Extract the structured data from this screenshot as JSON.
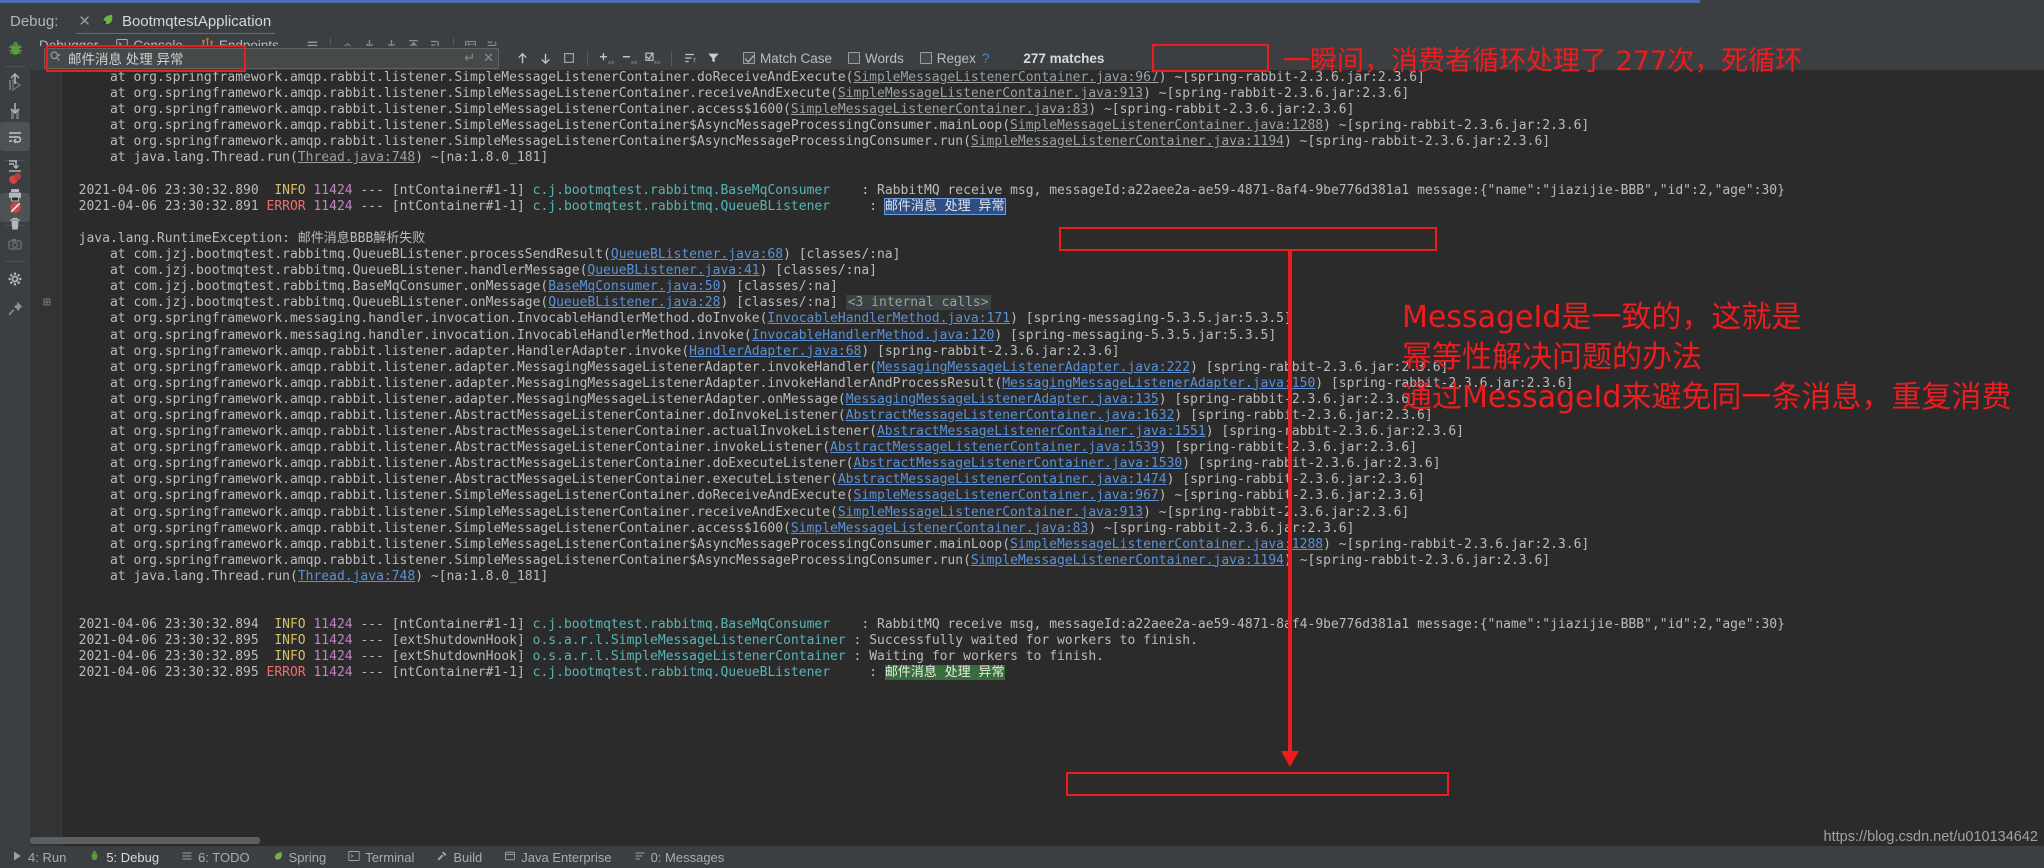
{
  "window": {
    "debug_label": "Debug:",
    "run_config_name": "BootmqtestApplication",
    "close_icon": "close-icon",
    "run_icon": "spring-boot-run-icon"
  },
  "tabs": [
    {
      "label": "Debugger",
      "icon": "",
      "active": false
    },
    {
      "label": "Console",
      "icon": "console-icon",
      "active": true
    },
    {
      "label": "Endpoints",
      "icon": "endpoints-icon",
      "active": false
    }
  ],
  "toolbar_icons": [
    "hamburger-menu-icon",
    "soft-wrap-icon",
    "scroll-to-end-icon",
    "scroll-down-icon",
    "scroll-up-icon",
    "jump-to-end-icon",
    "table-icon",
    "align-icon"
  ],
  "left_rail_icons": [
    "debug-bug-icon",
    "resume-program-icon",
    "pause-program-icon",
    "stop-icon",
    "view-breakpoints-icon",
    "mute-breakpoints-icon",
    "camera-settings-icon",
    "settings-gear-icon",
    "pin-tab-icon"
  ],
  "console_rail_icons": [
    "scroll-up-icon",
    "scroll-down-icon",
    "soft-wrap-icon",
    "scroll-to-end-icon",
    "print-icon",
    "trash-icon"
  ],
  "search": {
    "placeholder": "",
    "value": "邮件消息 处理 异常",
    "search_icon": "search-dropdown-icon",
    "newline_icon": "new-line-icon",
    "clear_icon": "clear-icon",
    "prev_icon": "find-previous-icon",
    "next_icon": "find-next-icon",
    "select_all_icon": "select-all-occurrences-icon",
    "add_icon": "add-occurrence-icon",
    "remove_icon": "remove-occurrence-icon",
    "toggle_icon": "toggle-occurrence-icon",
    "sort_icon": "sort-icon",
    "filter_icon": "filter-icon",
    "match_case": {
      "label": "Match Case",
      "checked": true
    },
    "words": {
      "label": "Words",
      "checked": false
    },
    "regex": {
      "label": "Regex",
      "checked": false
    },
    "help": "?",
    "matches": "277 matches"
  },
  "annotations": {
    "top_note": "一瞬间，消费者循环处理了 277次，死循环",
    "right_note_line1": "MessageId是一致的，这就是",
    "right_note_line2": "幂等性解决问题的办法",
    "right_note_line3": "通过MessageId来避免同一条消息，重复消费"
  },
  "statusbar": {
    "items": [
      {
        "label": "4: Run",
        "icon": "run-icon",
        "active": false
      },
      {
        "label": "5: Debug",
        "icon": "debug-bug-icon",
        "active": true
      },
      {
        "label": "6: TODO",
        "icon": "todo-icon",
        "active": false
      },
      {
        "label": "Spring",
        "icon": "spring-leaf-icon",
        "active": false
      },
      {
        "label": "Terminal",
        "icon": "terminal-icon",
        "active": false
      },
      {
        "label": "Build",
        "icon": "build-hammer-icon",
        "active": false
      },
      {
        "label": "Java Enterprise",
        "icon": "java-enterprise-icon",
        "active": false
      },
      {
        "label": "0: Messages",
        "icon": "messages-icon",
        "active": false
      }
    ],
    "watermark": "https://blog.csdn.net/u010134642"
  },
  "console_log": {
    "lines": [
      {
        "type": "trace",
        "indent": 4,
        "text": "at org.springframework.amqp.rabbit.listener.SimpleMessageListenerContainer.doReceiveAndExecute(",
        "link": "SimpleMessageListenerContainer.java:967",
        "tail": ") ~[spring-rabbit-2.3.6.jar:2.3.6]",
        "clipped_top": true
      },
      {
        "type": "trace",
        "indent": 4,
        "text": "at org.springframework.amqp.rabbit.listener.SimpleMessageListenerContainer.receiveAndExecute(",
        "link": "SimpleMessageListenerContainer.java:913",
        "tail": ") ~[spring-rabbit-2.3.6.jar:2.3.6]"
      },
      {
        "type": "trace",
        "indent": 4,
        "text": "at org.springframework.amqp.rabbit.listener.SimpleMessageListenerContainer.access$1600(",
        "link": "SimpleMessageListenerContainer.java:83",
        "tail": ") ~[spring-rabbit-2.3.6.jar:2.3.6]"
      },
      {
        "type": "trace",
        "indent": 4,
        "text": "at org.springframework.amqp.rabbit.listener.SimpleMessageListenerContainer$AsyncMessageProcessingConsumer.mainLoop(",
        "link": "SimpleMessageListenerContainer.java:1288",
        "tail": ") ~[spring-rabbit-2.3.6.jar:2.3.6]"
      },
      {
        "type": "trace",
        "indent": 4,
        "text": "at org.springframework.amqp.rabbit.listener.SimpleMessageListenerContainer$AsyncMessageProcessingConsumer.run(",
        "link": "SimpleMessageListenerContainer.java:1194",
        "tail": ") ~[spring-rabbit-2.3.6.jar:2.3.6]"
      },
      {
        "type": "trace",
        "indent": 4,
        "text": "at java.lang.Thread.run(",
        "link": "Thread.java:748",
        "tail": ") ~[na:1.8.0_181]"
      },
      {
        "type": "blank"
      },
      {
        "type": "log",
        "date": "2021-04-06 23:30:32.890",
        "level": "INFO",
        "pid": "11424",
        "thread": "[ntContainer#1-1]",
        "logger": "c.j.bootmqtest.rabbitmq.BaseMqConsumer",
        "loggerpad": "   ",
        "message": ": RabbitMQ receive msg, ",
        "boxed": "messageId:a22aee2a-ae59-4871-8af4-9be776d381a1",
        "after": " message:{\"name\":\"jiazijie-BBB\",\"id\":2,\"age\":30}"
      },
      {
        "type": "log",
        "date": "2021-04-06 23:30:32.891",
        "level": "ERROR",
        "pid": "11424",
        "thread": "[ntContainer#1-1]",
        "logger": "c.j.bootmqtest.rabbitmq.QueueBListener",
        "loggerpad": "    ",
        "message": ": ",
        "highlight_blue": "邮件消息 处理 异常"
      },
      {
        "type": "blank"
      },
      {
        "type": "exception",
        "text": "java.lang.RuntimeException: 邮件消息BBB解析失败"
      },
      {
        "type": "trace",
        "indent": 4,
        "text": "at com.jzj.bootmqtest.rabbitmq.QueueBListener.processSendResult(",
        "link": "QueueBListener.java:68",
        "tail": ") [classes/:na]"
      },
      {
        "type": "trace",
        "indent": 4,
        "text": "at com.jzj.bootmqtest.rabbitmq.QueueBListener.handlerMessage(",
        "link": "QueueBListener.java:41",
        "tail": ") [classes/:na]"
      },
      {
        "type": "trace",
        "indent": 4,
        "text": "at com.jzj.bootmqtest.rabbitmq.BaseMqConsumer.onMessage(",
        "link": "BaseMqConsumer.java:50",
        "tail": ") [classes/:na]"
      },
      {
        "type": "trace",
        "indent": 4,
        "fold": true,
        "text": "at com.jzj.bootmqtest.rabbitmq.QueueBListener.onMessage(",
        "link": "QueueBListener.java:28",
        "tail": ") [classes/:na] ",
        "folded": "<3 internal calls>"
      },
      {
        "type": "trace",
        "indent": 4,
        "text": "at org.springframework.messaging.handler.invocation.InvocableHandlerMethod.doInvoke(",
        "link": "InvocableHandlerMethod.java:171",
        "tail": ") [spring-messaging-5.3.5.jar:5.3.5]"
      },
      {
        "type": "trace",
        "indent": 4,
        "text": "at org.springframework.messaging.handler.invocation.InvocableHandlerMethod.invoke(",
        "link": "InvocableHandlerMethod.java:120",
        "tail": ") [spring-messaging-5.3.5.jar:5.3.5]"
      },
      {
        "type": "trace",
        "indent": 4,
        "text": "at org.springframework.amqp.rabbit.listener.adapter.HandlerAdapter.invoke(",
        "link": "HandlerAdapter.java:68",
        "tail": ") [spring-rabbit-2.3.6.jar:2.3.6]"
      },
      {
        "type": "trace",
        "indent": 4,
        "text": "at org.springframework.amqp.rabbit.listener.adapter.MessagingMessageListenerAdapter.invokeHandler(",
        "link": "MessagingMessageListenerAdapter.java:222",
        "tail": ") [spring-rabbit-2.3.6.jar:2.3.6]"
      },
      {
        "type": "trace",
        "indent": 4,
        "text": "at org.springframework.amqp.rabbit.listener.adapter.MessagingMessageListenerAdapter.invokeHandlerAndProcessResult(",
        "link": "MessagingMessageListenerAdapter.java:150",
        "tail": ") [spring-rabbit-2.3.6.jar:2.3.6]"
      },
      {
        "type": "trace",
        "indent": 4,
        "text": "at org.springframework.amqp.rabbit.listener.adapter.MessagingMessageListenerAdapter.onMessage(",
        "link": "MessagingMessageListenerAdapter.java:135",
        "tail": ") [spring-rabbit-2.3.6.jar:2.3.6]"
      },
      {
        "type": "trace",
        "indent": 4,
        "text": "at org.springframework.amqp.rabbit.listener.AbstractMessageListenerContainer.doInvokeListener(",
        "link": "AbstractMessageListenerContainer.java:1632",
        "tail": ") [spring-rabbit-2.3.6.jar:2.3.6]"
      },
      {
        "type": "trace",
        "indent": 4,
        "text": "at org.springframework.amqp.rabbit.listener.AbstractMessageListenerContainer.actualInvokeListener(",
        "link": "AbstractMessageListenerContainer.java:1551",
        "tail": ") [spring-rabbit-2.3.6.jar:2.3.6]"
      },
      {
        "type": "trace",
        "indent": 4,
        "text": "at org.springframework.amqp.rabbit.listener.AbstractMessageListenerContainer.invokeListener(",
        "link": "AbstractMessageListenerContainer.java:1539",
        "tail": ") [spring-rabbit-2.3.6.jar:2.3.6]"
      },
      {
        "type": "trace",
        "indent": 4,
        "text": "at org.springframework.amqp.rabbit.listener.AbstractMessageListenerContainer.doExecuteListener(",
        "link": "AbstractMessageListenerContainer.java:1530",
        "tail": ") [spring-rabbit-2.3.6.jar:2.3.6]"
      },
      {
        "type": "trace",
        "indent": 4,
        "text": "at org.springframework.amqp.rabbit.listener.AbstractMessageListenerContainer.executeListener(",
        "link": "AbstractMessageListenerContainer.java:1474",
        "tail": ") [spring-rabbit-2.3.6.jar:2.3.6]"
      },
      {
        "type": "trace",
        "indent": 4,
        "text": "at org.springframework.amqp.rabbit.listener.SimpleMessageListenerContainer.doReceiveAndExecute(",
        "link": "SimpleMessageListenerContainer.java:967",
        "tail": ") ~[spring-rabbit-2.3.6.jar:2.3.6]"
      },
      {
        "type": "trace",
        "indent": 4,
        "text": "at org.springframework.amqp.rabbit.listener.SimpleMessageListenerContainer.receiveAndExecute(",
        "link": "SimpleMessageListenerContainer.java:913",
        "tail": ") ~[spring-rabbit-2.3.6.jar:2.3.6]"
      },
      {
        "type": "trace",
        "indent": 4,
        "text": "at org.springframework.amqp.rabbit.listener.SimpleMessageListenerContainer.access$1600(",
        "link": "SimpleMessageListenerContainer.java:83",
        "tail": ") ~[spring-rabbit-2.3.6.jar:2.3.6]"
      },
      {
        "type": "trace",
        "indent": 4,
        "text": "at org.springframework.amqp.rabbit.listener.SimpleMessageListenerContainer$AsyncMessageProcessingConsumer.mainLoop(",
        "link": "SimpleMessageListenerContainer.java:1288",
        "tail": ") ~[spring-rabbit-2.3.6.jar:2.3.6]"
      },
      {
        "type": "trace",
        "indent": 4,
        "text": "at org.springframework.amqp.rabbit.listener.SimpleMessageListenerContainer$AsyncMessageProcessingConsumer.run(",
        "link": "SimpleMessageListenerContainer.java:1194",
        "tail": ") ~[spring-rabbit-2.3.6.jar:2.3.6]"
      },
      {
        "type": "trace",
        "indent": 4,
        "text": "at java.lang.Thread.run(",
        "link": "Thread.java:748",
        "tail": ") ~[na:1.8.0_181]"
      },
      {
        "type": "blank"
      },
      {
        "type": "blank"
      },
      {
        "type": "log",
        "date": "2021-04-06 23:30:32.894",
        "level": "INFO",
        "pid": "11424",
        "thread": "[ntContainer#1-1]",
        "logger": "c.j.bootmqtest.rabbitmq.BaseMqConsumer",
        "loggerpad": "   ",
        "message": ": RabbitMQ receive msg, ",
        "boxed": "messageId:a22aee2a-ae59-4871-8af4-9be776d381a1",
        "after": " message:{\"name\":\"jiazijie-BBB\",\"id\":2,\"age\":30}"
      },
      {
        "type": "log",
        "date": "2021-04-06 23:30:32.895",
        "level": "INFO",
        "pid": "11424",
        "thread": "[extShutdownHook]",
        "logger": "o.s.a.r.l.SimpleMessageListenerContainer",
        "loggerpad": "",
        "message": ": Successfully waited for workers to finish."
      },
      {
        "type": "log",
        "date": "2021-04-06 23:30:32.895",
        "level": "INFO",
        "pid": "11424",
        "thread": "[extShutdownHook]",
        "logger": "o.s.a.r.l.SimpleMessageListenerContainer",
        "loggerpad": "",
        "message": ": Waiting for workers to finish."
      },
      {
        "type": "log",
        "date": "2021-04-06 23:30:32.895",
        "level": "ERROR",
        "pid": "11424",
        "thread": "[ntContainer#1-1]",
        "logger": "c.j.bootmqtest.rabbitmq.QueueBListener",
        "loggerpad": "    ",
        "message": ": ",
        "highlight_green": "邮件消息 处理 异常"
      }
    ]
  },
  "colors": {
    "accent_blue": "#4b6eaf",
    "annotation_red": "#ee1c1c",
    "console_bg": "#2b2b2b",
    "chrome_bg": "#3c3f41",
    "info_yellow": "#d2c06a",
    "error_red": "#f26d6d",
    "logger_cyan": "#58b5b5",
    "pid_purple": "#c085c0",
    "link_blue": "#5b91d6"
  }
}
